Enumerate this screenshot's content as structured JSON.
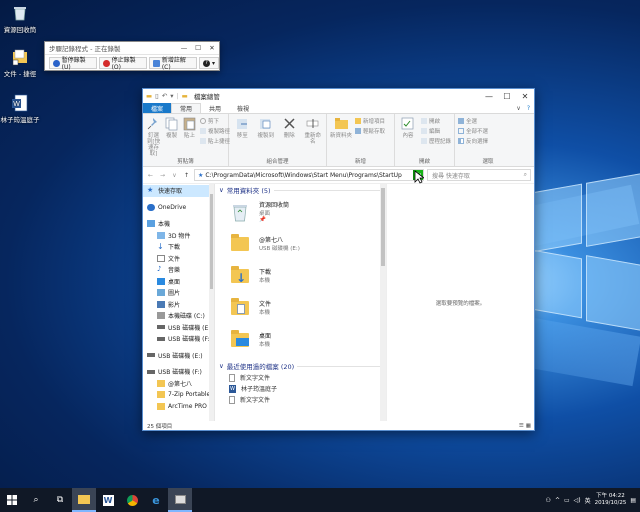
{
  "desktop": {
    "icons": [
      {
        "label": "資源回收筒"
      },
      {
        "label": "文件 - 捷徑"
      },
      {
        "label": "林子筠溫庭子"
      }
    ]
  },
  "mini_window": {
    "title": "步驟記錄程式 - 正在錄製",
    "buttons": [
      {
        "label": "暫停錄製(U)"
      },
      {
        "label": "停止錄製(O)"
      },
      {
        "label": "新增註解(C)"
      }
    ],
    "help": "?"
  },
  "explorer": {
    "title": "檔案總管",
    "title_controls": [
      "—",
      "☐",
      "✕"
    ],
    "tabs": [
      "檔案",
      "常用",
      "共用",
      "檢視"
    ],
    "ribbon": {
      "clipboard": {
        "label": "剪貼簿",
        "pin": "釘選到[快速存取]",
        "copy": "複製",
        "paste": "貼上",
        "cut": "剪下",
        "copy_path": "複製路徑",
        "paste_shortcut": "貼上捷徑"
      },
      "organize": {
        "label": "組合管理",
        "move_to": "移至",
        "copy_to": "複製到",
        "delete": "刪除",
        "rename": "重新命名"
      },
      "new": {
        "label": "新增",
        "new_folder": "新資料夾",
        "new_item": "新增項目",
        "easy_access": "輕鬆存取"
      },
      "open": {
        "label": "開啟",
        "properties": "內容",
        "open": "開啟",
        "edit": "編輯",
        "history": "歷程記錄"
      },
      "select": {
        "label": "選取",
        "select_all": "全選",
        "select_none": "全部不選",
        "invert": "反向選擇"
      }
    },
    "address": "C:\\ProgramData\\Microsoft\\Windows\\Start Menu\\Programs\\StartUp",
    "search_placeholder": "搜尋 快速存取",
    "nav": [
      {
        "label": "快速存取",
        "level": 1,
        "selected": true
      },
      {
        "label": "OneDrive",
        "level": 1
      },
      {
        "label": "本機",
        "level": 1
      },
      {
        "label": "3D 物件",
        "level": 2
      },
      {
        "label": "下載",
        "level": 2
      },
      {
        "label": "文件",
        "level": 2
      },
      {
        "label": "音樂",
        "level": 2
      },
      {
        "label": "桌面",
        "level": 2
      },
      {
        "label": "圖片",
        "level": 2
      },
      {
        "label": "影片",
        "level": 2
      },
      {
        "label": "本機磁碟 (C:)",
        "level": 2
      },
      {
        "label": "USB 磁碟機 (E:)",
        "level": 2
      },
      {
        "label": "USB 磁碟機 (F:)",
        "level": 2
      },
      {
        "label": "USB 磁碟機 (E:)",
        "level": 1
      },
      {
        "label": "USB 磁碟機 (F:)",
        "level": 1
      },
      {
        "label": "@第七八",
        "level": 3
      },
      {
        "label": "7-Zip Portable",
        "level": 3
      },
      {
        "label": "ArcTime PRO",
        "level": 3
      }
    ],
    "frequent_header": "常用資料夾 (5)",
    "frequent": [
      {
        "name": "資源回收筒",
        "sub": "桌面",
        "icon": "recycle-bin"
      },
      {
        "name": "@第七八",
        "sub": "USB 磁碟機 (E:)",
        "icon": "folder"
      },
      {
        "name": "下載",
        "sub": "本機",
        "icon": "downloads-folder"
      },
      {
        "name": "文件",
        "sub": "本機",
        "icon": "documents-folder"
      },
      {
        "name": "桌面",
        "sub": "本機",
        "icon": "desktop-folder"
      }
    ],
    "recent_header": "最近使用過的檔案 (20)",
    "recent": [
      {
        "name": "新文字文件"
      },
      {
        "name": "林子筠溫庭子"
      },
      {
        "name": "新文字文件"
      }
    ],
    "preview_text": "選取要預覽的檔案。",
    "status": "25 個項目"
  },
  "taskbar": {
    "clock_time": "下午 04:22",
    "clock_date": "2019/10/25",
    "ime": "英"
  }
}
